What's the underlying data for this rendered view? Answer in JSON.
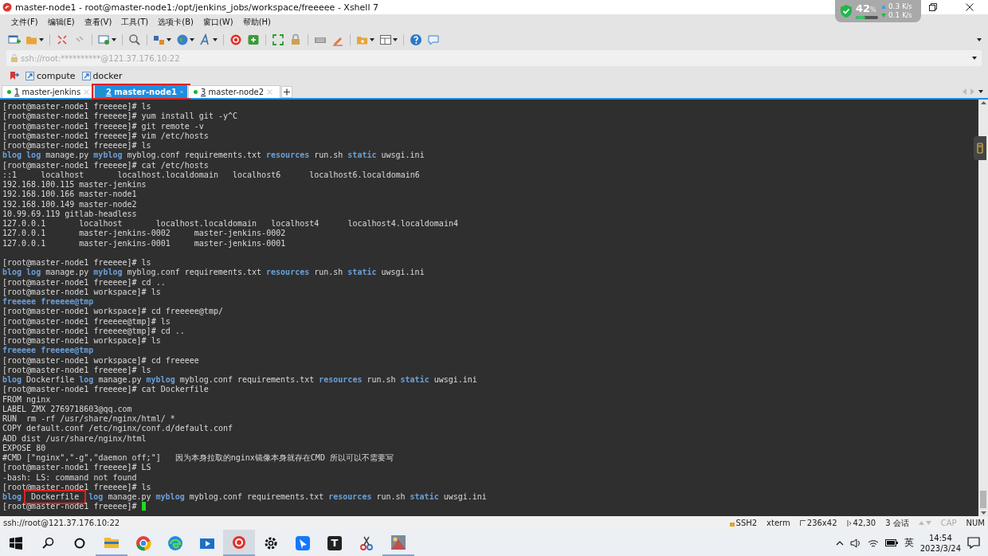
{
  "window": {
    "title": "master-node1 - root@master-node1:/opt/jenkins_jobs/workspace/freeeee - Xshell 7"
  },
  "security_widget": {
    "percent": "42",
    "unit": "%",
    "level": 0.42,
    "upload": "0.3",
    "upload_unit": "K/s",
    "download": "0.1",
    "download_unit": "K/s"
  },
  "menu": [
    "文件(F)",
    "编辑(E)",
    "查看(V)",
    "工具(T)",
    "选项卡(B)",
    "窗口(W)",
    "帮助(H)"
  ],
  "address": {
    "value": "ssh://root:**********@121.37.176.10:22"
  },
  "links": [
    "compute",
    "docker"
  ],
  "tabs": [
    {
      "number": "1",
      "label": "master-jenkins",
      "selected": false,
      "highlighted": false
    },
    {
      "number": "2",
      "label": "master-node1",
      "selected": true,
      "highlighted": true
    },
    {
      "number": "3",
      "label": "master-node2",
      "selected": false,
      "highlighted": false
    }
  ],
  "terminal": {
    "lines": [
      {
        "text": "[root@master-node1 freeeee]# ls"
      },
      {
        "text": "[root@master-node1 freeeee]# yum install git -y^C"
      },
      {
        "text": "[root@master-node1 freeeee]# git remote -v"
      },
      {
        "text": "[root@master-node1 freeeee]# vim /etc/hosts"
      },
      {
        "text": "[root@master-node1 freeeee]# ls"
      },
      {
        "kind": "ls",
        "items": [
          {
            "text": "blog",
            "dir": true
          },
          {
            "text": "log",
            "dir": true
          },
          {
            "text": "manage.py",
            "dir": false
          },
          {
            "text": "myblog",
            "dir": true
          },
          {
            "text": "myblog.conf",
            "dir": false
          },
          {
            "text": "requirements.txt",
            "dir": false
          },
          {
            "text": "resources",
            "dir": true
          },
          {
            "text": "run.sh",
            "dir": false
          },
          {
            "text": "static",
            "dir": true
          },
          {
            "text": "uwsgi.ini",
            "dir": false
          }
        ]
      },
      {
        "text": "[root@master-node1 freeeee]# cat /etc/hosts"
      },
      {
        "text": "::1     localhost       localhost.localdomain   localhost6      localhost6.localdomain6"
      },
      {
        "text": "192.168.100.115 master-jenkins"
      },
      {
        "text": "192.168.100.166 master-node1"
      },
      {
        "text": "192.168.100.149 master-node2"
      },
      {
        "text": "10.99.69.119 gitlab-headless"
      },
      {
        "text": "127.0.0.1       localhost       localhost.localdomain   localhost4      localhost4.localdomain4"
      },
      {
        "text": "127.0.0.1       master-jenkins-0002     master-jenkins-0002"
      },
      {
        "text": "127.0.0.1       master-jenkins-0001     master-jenkins-0001"
      },
      {
        "kind": "blank"
      },
      {
        "text": "[root@master-node1 freeeee]# ls"
      },
      {
        "kind": "ls",
        "items": [
          {
            "text": "blog",
            "dir": true
          },
          {
            "text": "log",
            "dir": true
          },
          {
            "text": "manage.py",
            "dir": false
          },
          {
            "text": "myblog",
            "dir": true
          },
          {
            "text": "myblog.conf",
            "dir": false
          },
          {
            "text": "requirements.txt",
            "dir": false
          },
          {
            "text": "resources",
            "dir": true
          },
          {
            "text": "run.sh",
            "dir": false
          },
          {
            "text": "static",
            "dir": true
          },
          {
            "text": "uwsgi.ini",
            "dir": false
          }
        ]
      },
      {
        "text": "[root@master-node1 freeeee]# cd .."
      },
      {
        "text": "[root@master-node1 workspace]# ls"
      },
      {
        "kind": "ls",
        "items": [
          {
            "text": "freeeee",
            "dir": true
          },
          {
            "text": "freeeee@tmp",
            "dir": true
          }
        ]
      },
      {
        "text": "[root@master-node1 workspace]# cd freeeee@tmp/"
      },
      {
        "text": "[root@master-node1 freeeee@tmp]# ls"
      },
      {
        "text": "[root@master-node1 freeeee@tmp]# cd .."
      },
      {
        "text": "[root@master-node1 workspace]# ls"
      },
      {
        "kind": "ls",
        "items": [
          {
            "text": "freeeee",
            "dir": true
          },
          {
            "text": "freeeee@tmp",
            "dir": true
          }
        ]
      },
      {
        "text": "[root@master-node1 workspace]# cd freeeee"
      },
      {
        "text": "[root@master-node1 freeeee]# ls"
      },
      {
        "kind": "ls",
        "items": [
          {
            "text": "blog",
            "dir": true
          },
          {
            "text": "Dockerfile",
            "dir": false
          },
          {
            "text": "log",
            "dir": true
          },
          {
            "text": "manage.py",
            "dir": false
          },
          {
            "text": "myblog",
            "dir": true
          },
          {
            "text": "myblog.conf",
            "dir": false
          },
          {
            "text": "requirements.txt",
            "dir": false
          },
          {
            "text": "resources",
            "dir": true
          },
          {
            "text": "run.sh",
            "dir": false
          },
          {
            "text": "static",
            "dir": true
          },
          {
            "text": "uwsgi.ini",
            "dir": false
          }
        ]
      },
      {
        "text": "[root@master-node1 freeeee]# cat Dockerfile"
      },
      {
        "text": "FROM nginx"
      },
      {
        "text": "LABEL ZMX 2769718603@qq.com"
      },
      {
        "text": "RUN  rm -rf /usr/share/nginx/html/ *"
      },
      {
        "text": "COPY default.conf /etc/nginx/conf.d/default.conf"
      },
      {
        "text": "ADD dist /usr/share/nginx/html"
      },
      {
        "text": "EXPOSE 80"
      },
      {
        "text": "#CMD [\"nginx\",\"-g\",\"daemon off;\"]   因为本身拉取的nginx镜像本身就存在CMD 所以可以不需要写"
      },
      {
        "text": "[root@master-node1 freeeee]# LS"
      },
      {
        "text": "-bash: LS: command not found"
      },
      {
        "text": "[root@master-node1 freeeee]# ls"
      },
      {
        "kind": "ls",
        "items": [
          {
            "text": "blog",
            "dir": true
          },
          {
            "text": "Dockerfile",
            "dir": false,
            "highlighted": true
          },
          {
            "text": "log",
            "dir": true
          },
          {
            "text": "manage.py",
            "dir": false
          },
          {
            "text": "myblog",
            "dir": true
          },
          {
            "text": "myblog.conf",
            "dir": false
          },
          {
            "text": "requirements.txt",
            "dir": false
          },
          {
            "text": "resources",
            "dir": true
          },
          {
            "text": "run.sh",
            "dir": false
          },
          {
            "text": "static",
            "dir": true
          },
          {
            "text": "uwsgi.ini",
            "dir": false
          }
        ]
      },
      {
        "text": "[root@master-node1 freeeee]# ",
        "cursor": true
      }
    ]
  },
  "status_bar": {
    "connection": "ssh://root@121.37.176.10:22",
    "items": [
      {
        "kind": "protocol",
        "text": "SSH2"
      },
      {
        "kind": "plain",
        "text": "xterm"
      },
      {
        "kind": "size",
        "text": "236x42"
      },
      {
        "kind": "position",
        "text": "42,30"
      },
      {
        "kind": "plain",
        "text": "3 会话"
      },
      {
        "kind": "arrows"
      }
    ],
    "keys": [
      {
        "text": "CAP",
        "on": false
      },
      {
        "text": "NUM",
        "on": true
      }
    ]
  },
  "taskbar": {
    "apps": [
      {
        "kind": "explorer",
        "running": true,
        "active": false
      },
      {
        "kind": "chrome",
        "running": false,
        "active": false
      },
      {
        "kind": "edge",
        "running": false,
        "active": false
      },
      {
        "kind": "video",
        "running": false,
        "active": false
      },
      {
        "kind": "xshell",
        "running": true,
        "active": true
      },
      {
        "kind": "settings",
        "running": false,
        "active": false
      },
      {
        "kind": "feishu",
        "running": false,
        "active": false
      },
      {
        "kind": "letter",
        "glyph": "T",
        "running": false,
        "active": false
      },
      {
        "kind": "scissors",
        "running": false,
        "active": false
      },
      {
        "kind": "image",
        "running": true,
        "active": false
      }
    ],
    "ime": "英",
    "time": "14:54",
    "date": "2023/3/24"
  }
}
